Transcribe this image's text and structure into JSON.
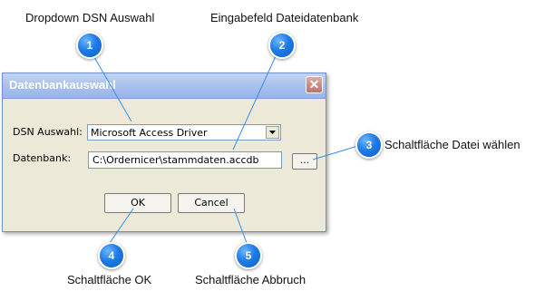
{
  "callouts": {
    "c1": {
      "number": "1",
      "label": "Dropdown DSN Auswahl"
    },
    "c2": {
      "number": "2",
      "label": "Eingabefeld Dateidatenbank"
    },
    "c3": {
      "number": "3",
      "label": "Schaltfläche Datei wählen"
    },
    "c4": {
      "number": "4",
      "label": "Schaltfläche OK"
    },
    "c5": {
      "number": "5",
      "label": "Schaltfläche Abbruch"
    }
  },
  "dialog": {
    "title": "Datenbankauswahl",
    "close_symbol": "✕",
    "dsn_label": "DSN Auswahl:",
    "dsn_selected": "Microsoft Access Driver",
    "db_label": "Datenbank:",
    "db_value": "C:\\Ordernicer\\stammdaten.accdb",
    "browse_label": "...",
    "ok_label": "OK",
    "cancel_label": "Cancel"
  },
  "colors": {
    "callout_badge": "#1e7be6",
    "callout_line": "#3b8ee8",
    "dialog_background": "#ece9d8",
    "titlebar": "#a9c1ee"
  },
  "icons": {
    "close": "close-icon",
    "dropdown": "chevron-down-icon"
  }
}
